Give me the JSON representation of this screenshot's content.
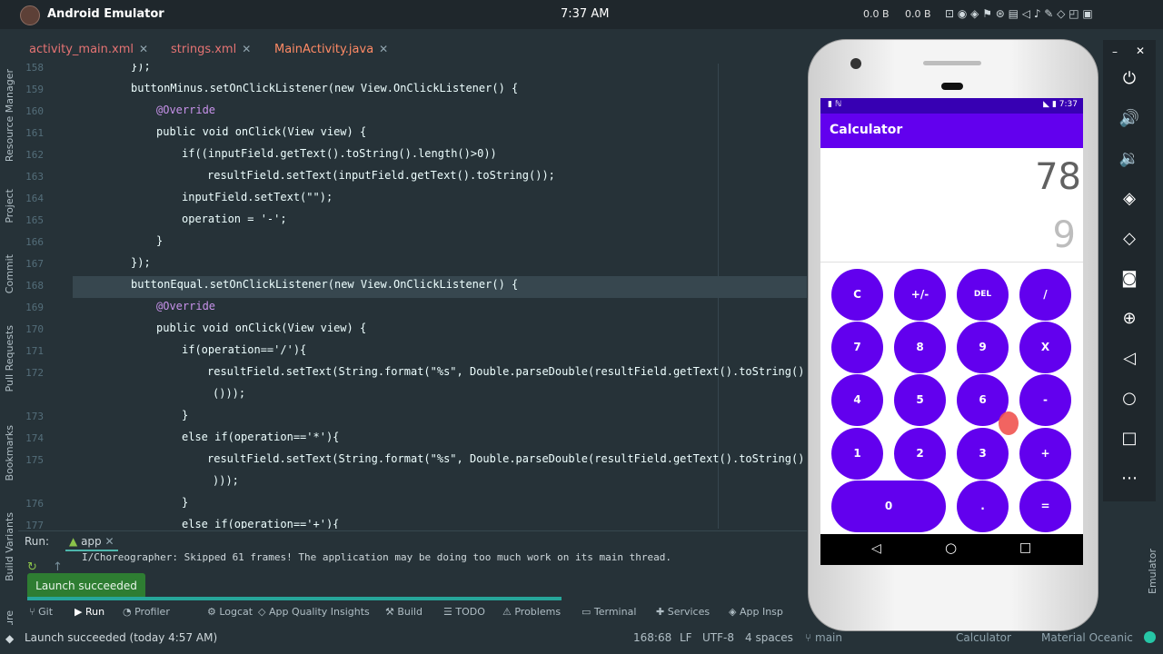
{
  "topbar": {
    "app_title": "Android Emulator",
    "clock": "7:37 AM",
    "net_down": "0.0 B",
    "net_up": "0.0 B"
  },
  "left_tools": [
    "Resource Manager",
    "Project",
    "Commit",
    "Pull Requests",
    "Bookmarks",
    "Build Variants",
    "ture"
  ],
  "tabs": [
    {
      "label": "activity_main.xml"
    },
    {
      "label": "strings.xml"
    },
    {
      "label": "MainActivity.java"
    }
  ],
  "editor": {
    "lines": [
      {
        "n": "158",
        "text": "});"
      },
      {
        "n": "159",
        "text": "buttonMinus.setOnClickListener(new View.OnClickListener() {"
      },
      {
        "n": "160",
        "text": "@Override"
      },
      {
        "n": "161",
        "text": "public void onClick(View view) {"
      },
      {
        "n": "162",
        "text": "if((inputField.getText().toString().length()>0))"
      },
      {
        "n": "163",
        "text": "resultField.setText(inputField.getText().toString());"
      },
      {
        "n": "164",
        "text": "inputField.setText(\"\");"
      },
      {
        "n": "165",
        "text": "operation = '-';"
      },
      {
        "n": "166",
        "text": "}"
      },
      {
        "n": "167",
        "text": "});"
      },
      {
        "n": "168",
        "text": "buttonEqual.setOnClickListener(new View.OnClickListener() {"
      },
      {
        "n": "169",
        "text": "@Override"
      },
      {
        "n": "170",
        "text": "public void onClick(View view) {"
      },
      {
        "n": "171",
        "text": "if(operation=='/'){"
      },
      {
        "n": "172",
        "text": "resultField.setText(String.format(\"%s\", Double.parseDouble(resultField.getText().toString()"
      },
      {
        "n": "",
        "text": "()));"
      },
      {
        "n": "173",
        "text": "}"
      },
      {
        "n": "174",
        "text": "else if(operation=='*'){"
      },
      {
        "n": "175",
        "text": "resultField.setText(String.format(\"%s\", Double.parseDouble(resultField.getText().toString()"
      },
      {
        "n": "",
        "text": ")));"
      },
      {
        "n": "176",
        "text": "}"
      },
      {
        "n": "177",
        "text": "else if(operation=='+'){"
      }
    ]
  },
  "run": {
    "label": "Run:",
    "config": "app",
    "log_line": "I/Choreographer: Skipped 61 frames!  The application may be doing too much work on its main thread.",
    "toast": "Launch succeeded"
  },
  "bottom_tools": [
    "Git",
    "Run",
    "Profiler",
    "Logcat",
    "App Quality Insights",
    "Build",
    "TODO",
    "Problems",
    "Terminal",
    "Services",
    "App Insp"
  ],
  "status": {
    "message": "Launch succeeded (today 4:57 AM)",
    "position": "168:68",
    "line_sep": "LF",
    "encoding": "UTF-8",
    "indent": "4 spaces",
    "branch": "main",
    "project": "Calculator",
    "theme": "Material Oceanic"
  },
  "emulator": {
    "status_time": "7:37",
    "app_title": "Calculator",
    "result": "78",
    "input": "9",
    "keys": [
      "C",
      "+/-",
      "DEL",
      "/",
      "7",
      "8",
      "9",
      "X",
      "4",
      "5",
      "6",
      "-",
      "1",
      "2",
      "3",
      "+",
      "0",
      ".",
      "="
    ],
    "accent": "#6200ee"
  }
}
